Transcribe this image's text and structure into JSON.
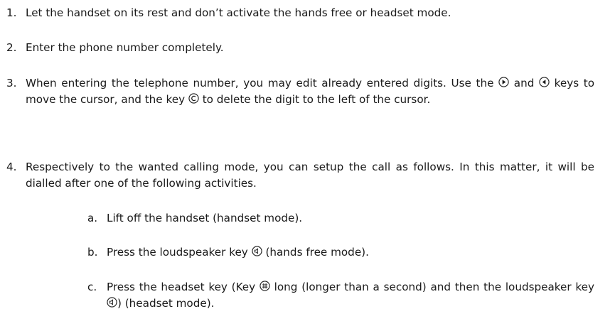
{
  "items": [
    {
      "num": "1.",
      "text": "Let the handset on its rest and don’t activate the hands free or headset mode."
    },
    {
      "num": "2.",
      "text": "Enter the phone number completely."
    },
    {
      "num": "3.",
      "text_a": "When entering the telephone number, you may edit already entered digits. Use the",
      "key_right": "⦿",
      "text_b": "and",
      "key_left": "⦿",
      "text_c": "keys to move the cursor, and the key",
      "key_c": "Ⓒ",
      "text_d": "to delete the digit to the left of the cursor."
    },
    {
      "num": "4.",
      "text": "Respectively to the wanted calling mode, you can setup the call as follows. In this matter, it will be dialled after one of the following activities."
    }
  ],
  "subitems": [
    {
      "num": "a.",
      "text": "Lift off the handset (handset mode)."
    },
    {
      "num": "b.",
      "text_a": "Press the loudspeaker key",
      "key_speaker": "◎",
      "text_b": "(hands free mode)."
    },
    {
      "num": "c.",
      "text_a": "Press the headset key (Key",
      "key_hash": "⊕",
      "text_b": "long (longer than a second) and then the loudspeaker key",
      "key_speaker": "◎",
      "text_c": ") (headset mode)."
    }
  ]
}
